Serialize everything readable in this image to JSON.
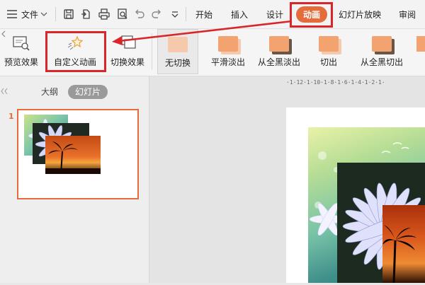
{
  "menubar": {
    "file_label": "文件",
    "tabs": [
      "开始",
      "插入",
      "设计",
      "动画",
      "幻灯片放映",
      "审阅"
    ],
    "active_tab": "动画",
    "active_tab_color": "#e46c3a"
  },
  "ribbon": {
    "preview_label": "预览效果",
    "custom_animation_label": "自定义动画",
    "switch_effect_label": "切换效果",
    "transitions": [
      {
        "label": "无切换",
        "color": "#f5c4a8"
      },
      {
        "label": "平滑淡出",
        "color": "#f0a070"
      },
      {
        "label": "从全黑淡出",
        "color": "#f0a070"
      },
      {
        "label": "切出",
        "color": "#f0a070"
      },
      {
        "label": "从全黑切出",
        "color": "#f0a070"
      }
    ]
  },
  "left_pane": {
    "outline_tab": "大纲",
    "slides_tab": "幻灯片",
    "slide_number": "1"
  },
  "ruler": {
    "text": "·1·12·1·10·1·8·1·6·1·4·1·2·1·"
  },
  "colors": {
    "highlight": "#d9262a",
    "accent": "#e46c3a"
  }
}
